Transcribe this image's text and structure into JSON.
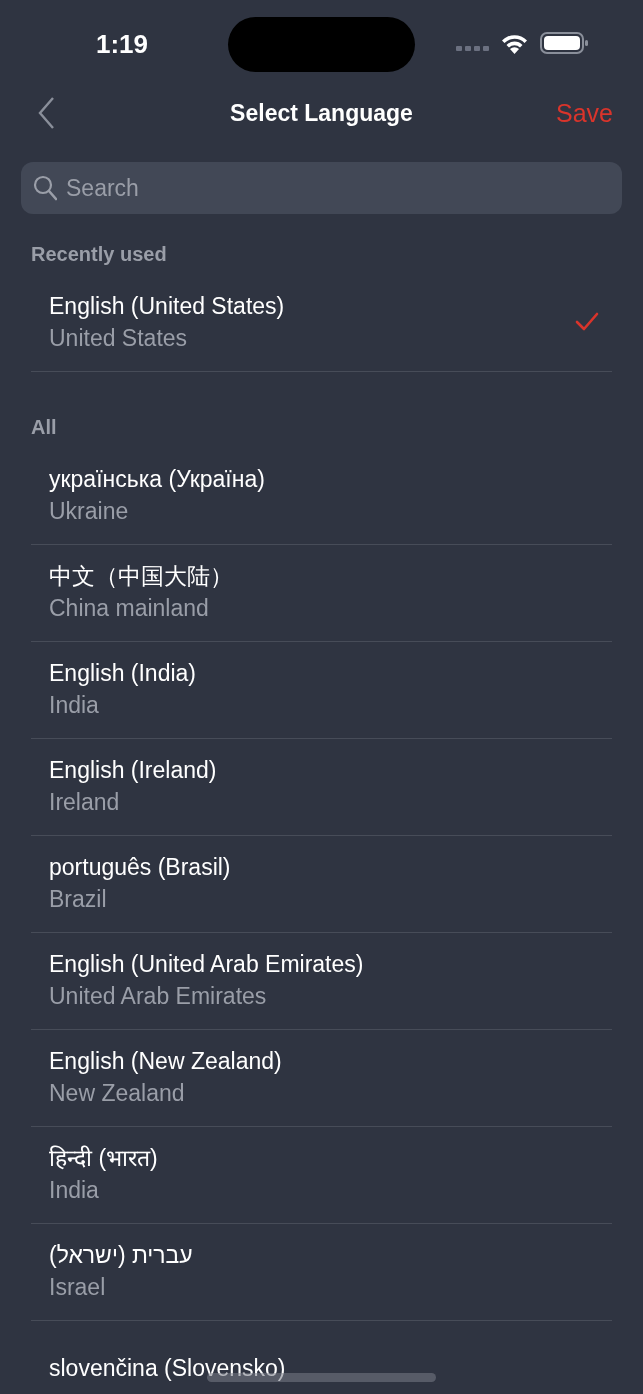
{
  "status_bar": {
    "time": "1:19"
  },
  "nav": {
    "title": "Select Language",
    "action": "Save"
  },
  "search": {
    "placeholder": "Search"
  },
  "sections": [
    {
      "title": "Recently used",
      "items": [
        {
          "name": "English (United States)",
          "region": "United States",
          "selected": true
        }
      ]
    },
    {
      "title": "All",
      "items": [
        {
          "name": "українська (Україна)",
          "region": "Ukraine",
          "selected": false
        },
        {
          "name": "中文（中国大陆）",
          "region": "China mainland",
          "selected": false
        },
        {
          "name": "English (India)",
          "region": "India",
          "selected": false
        },
        {
          "name": "English (Ireland)",
          "region": "Ireland",
          "selected": false
        },
        {
          "name": "português (Brasil)",
          "region": "Brazil",
          "selected": false
        },
        {
          "name": "English (United Arab Emirates)",
          "region": "United Arab Emirates",
          "selected": false
        },
        {
          "name": "English (New Zealand)",
          "region": "New Zealand",
          "selected": false
        },
        {
          "name": "हिन्दी (भारत)",
          "region": "India",
          "selected": false
        },
        {
          "name": "עברית (ישראל)",
          "region": "Israel",
          "selected": false
        },
        {
          "name": "slovenčina (Slovensko)",
          "selected": false
        }
      ]
    }
  ]
}
